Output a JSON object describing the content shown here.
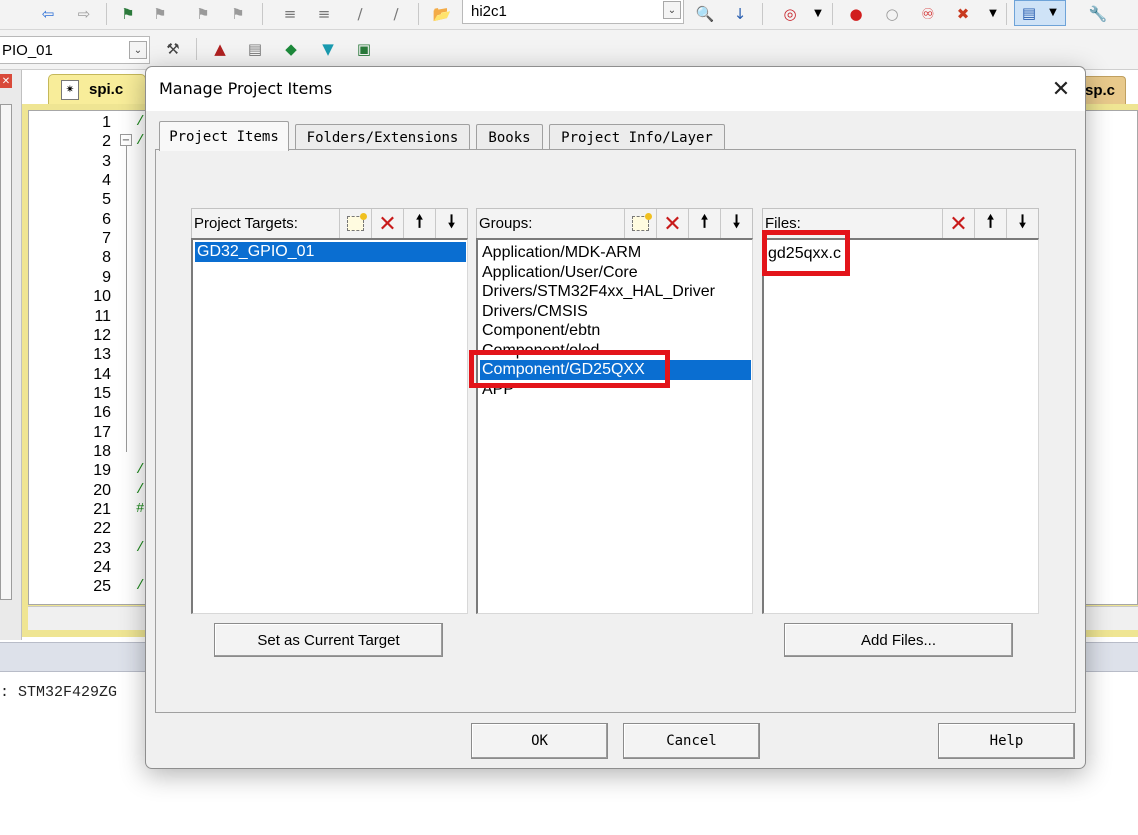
{
  "toolbar": {
    "target_combo": "hi2c1",
    "project_combo": "PIO_01"
  },
  "editor": {
    "tabs": [
      {
        "label": "spi.c"
      },
      {
        "label": "sp.c"
      }
    ],
    "line_numbers": [
      "1",
      "2",
      "3",
      "4",
      "5",
      "6",
      "7",
      "8",
      "9",
      "10",
      "11",
      "12",
      "13",
      "14",
      "15",
      "16",
      "17",
      "18",
      "19",
      "20",
      "21",
      "22",
      "23",
      "24",
      "25"
    ],
    "code_fragments": [
      "/",
      "/",
      "/",
      "/",
      "#",
      "/",
      "/"
    ]
  },
  "output": {
    "text": ": STM32F429ZG"
  },
  "dialog": {
    "title": "Manage Project Items",
    "tabs": [
      {
        "label": "Project Items",
        "active": true
      },
      {
        "label": "Folders/Extensions",
        "active": false
      },
      {
        "label": "Books",
        "active": false
      },
      {
        "label": "Project Info/Layer",
        "active": false
      }
    ],
    "targets": {
      "header": "Project Targets:",
      "items": [
        {
          "label": "GD32_GPIO_01",
          "selected": true
        }
      ]
    },
    "groups": {
      "header": "Groups:",
      "items": [
        {
          "label": "Application/MDK-ARM",
          "selected": false
        },
        {
          "label": "Application/User/Core",
          "selected": false
        },
        {
          "label": "Drivers/STM32F4xx_HAL_Driver",
          "selected": false
        },
        {
          "label": "Drivers/CMSIS",
          "selected": false
        },
        {
          "label": "Component/ebtn",
          "selected": false
        },
        {
          "label": "Component/oled",
          "selected": false
        },
        {
          "label": "Component/GD25QXX",
          "selected": true
        },
        {
          "label": "APP",
          "selected": false
        }
      ]
    },
    "files": {
      "header": "Files:",
      "items": [
        {
          "label": "gd25qxx.c",
          "selected": false
        }
      ]
    },
    "buttons": {
      "set_current_target": "Set as Current Target",
      "add_files": "Add Files...",
      "ok": "OK",
      "cancel": "Cancel",
      "help": "Help"
    },
    "highlight_color": "#e3141a",
    "selection_color": "#0a6ed1"
  }
}
